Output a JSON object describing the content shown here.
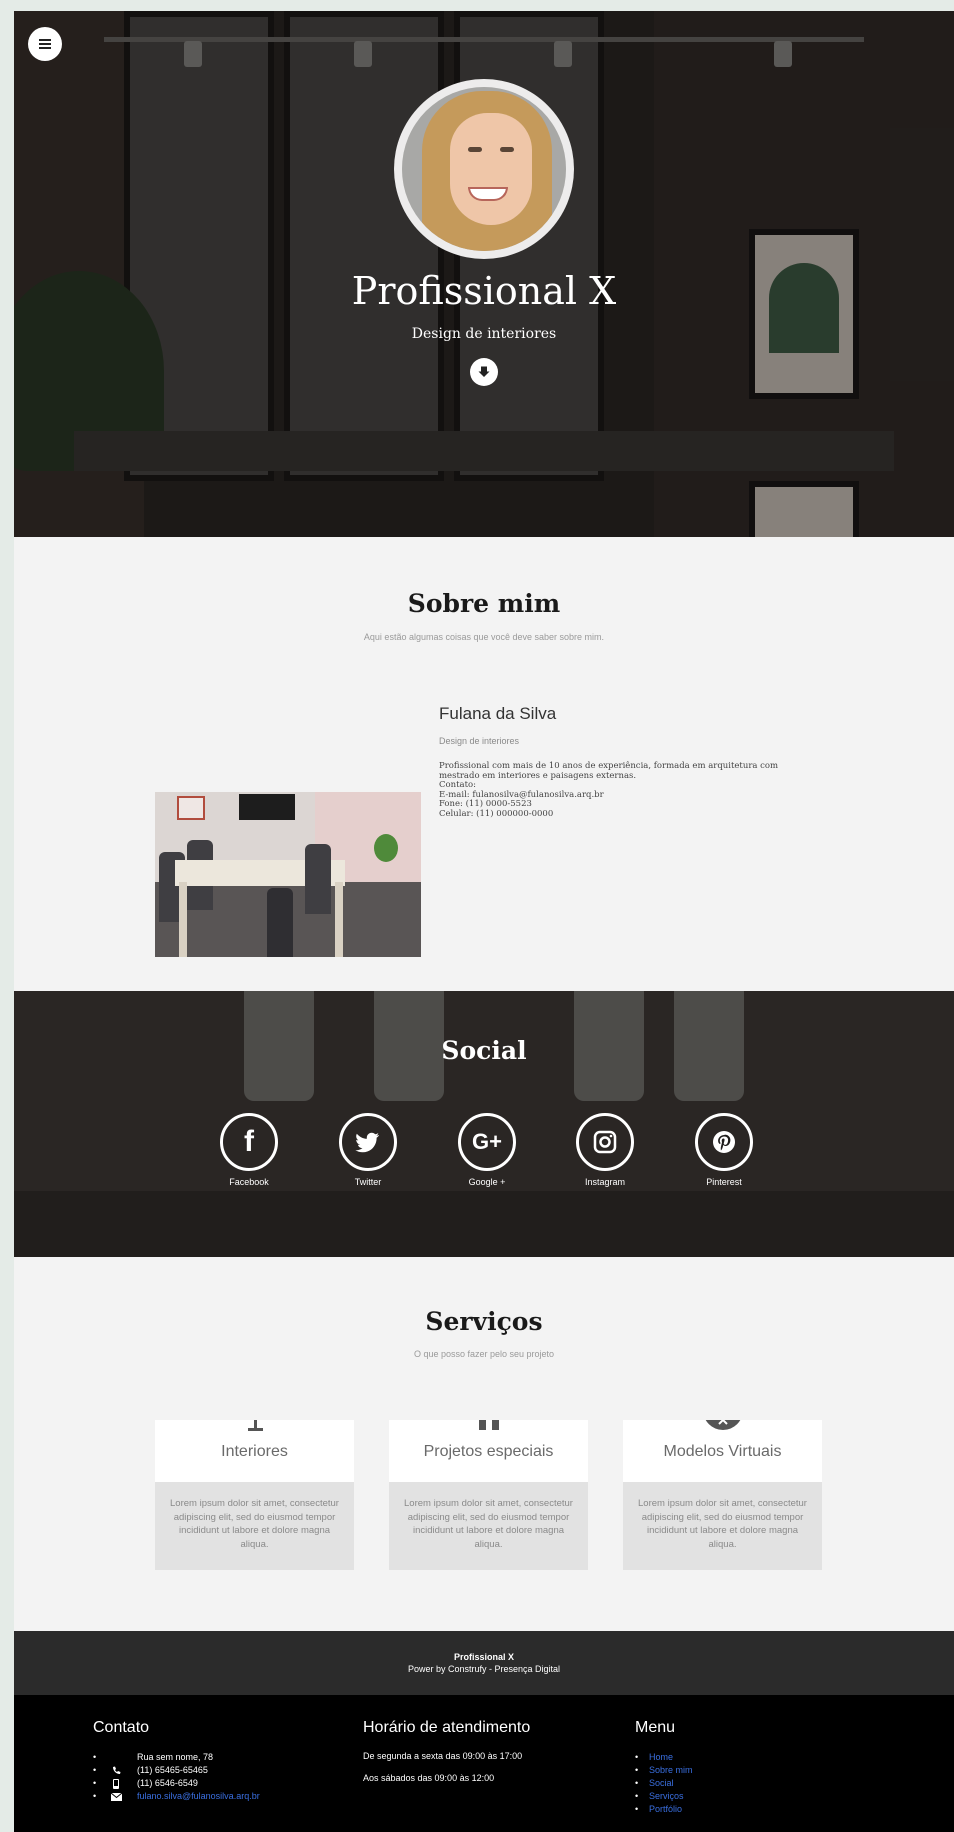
{
  "hero": {
    "title": "Profissional X",
    "subtitle": "Design de interiores"
  },
  "about": {
    "title": "Sobre mim",
    "subtitle": "Aqui estão algumas coisas que você deve saber sobre mim.",
    "name": "Fulana da Silva",
    "role": "Design de interiores",
    "description": [
      "Profissional com mais de 10 anos de experiência, formada em arquitetura com",
      "mestrado em interiores e paisagens externas.",
      "Contato:",
      "E-mail: fulanosilva@fulanosilva.arq.br",
      "Fone: (11) 0000-5523",
      "Celular: (11) 000000-0000"
    ]
  },
  "social": {
    "title": "Social",
    "items": [
      {
        "label": "Facebook",
        "icon": "facebook-icon"
      },
      {
        "label": "Twitter",
        "icon": "twitter-icon"
      },
      {
        "label": "Google +",
        "icon": "google-plus-icon"
      },
      {
        "label": "Instagram",
        "icon": "instagram-icon"
      },
      {
        "label": "Pinterest",
        "icon": "pinterest-icon"
      }
    ]
  },
  "services": {
    "title": "Serviços",
    "subtitle": "O que posso fazer pelo seu projeto",
    "cards": [
      {
        "title": "Interiores",
        "body": "Lorem ipsum dolor sit amet, consectetur adipiscing elit, sed do eiusmod tempor incididunt ut labore et dolore magna aliqua."
      },
      {
        "title": "Projetos especiais",
        "body": "Lorem ipsum dolor sit amet, consectetur adipiscing elit, sed do eiusmod tempor incididunt ut labore et dolore magna aliqua."
      },
      {
        "title": "Modelos Virtuais",
        "body": "Lorem ipsum dolor sit amet, consectetur adipiscing elit, sed do eiusmod tempor incididunt ut labore et dolore magna aliqua."
      }
    ]
  },
  "footer": {
    "brand": "Profissional X",
    "powered": "Power by Construfy - Presença Digital",
    "contact": {
      "title": "Contato",
      "address": "Rua sem nome, 78",
      "phone": "(11) 65465-65465",
      "mobile": "(11) 6546-6549",
      "email": "fulano.silva@fulanosilva.arq.br"
    },
    "hours": {
      "title": "Horário de atendimento",
      "weekdays": "De segunda a sexta das 09:00 às 17:00",
      "saturday": "Aos sábados das 09:00 às 12:00"
    },
    "menu": {
      "title": "Menu",
      "links": [
        "Home",
        "Sobre mim",
        "Social",
        "Serviços",
        "Portfólio"
      ]
    }
  },
  "colors": {
    "page_background": "#f3f3f3",
    "footer_top": "#2b2b2b",
    "footer_bottom": "#000000",
    "link": "#3a6fe0"
  }
}
